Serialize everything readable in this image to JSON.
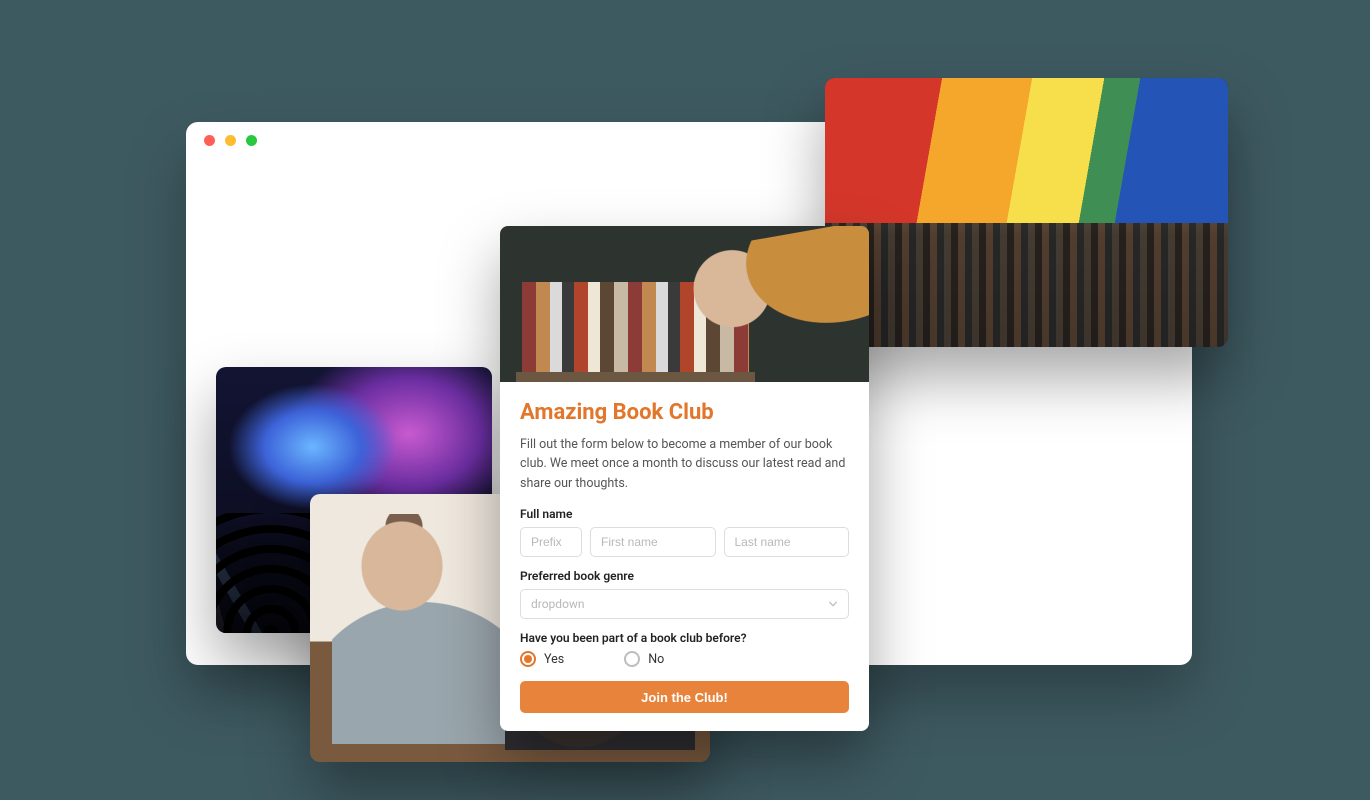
{
  "colors": {
    "accent": "#e2762a"
  },
  "window": {
    "traffic_lights": [
      "close",
      "minimize",
      "maximize"
    ]
  },
  "photos": {
    "rainbow_alt": "Crowd under large rainbow flag",
    "concert_alt": "Concert crowd with blue and purple stage lights",
    "couple_alt": "Two friends talking at a table"
  },
  "form": {
    "hero_alt": "Hand reaching for books on a shelf",
    "title": "Amazing Book Club",
    "description": "Fill out the form below to become a member of our book club. We meet once a month to discuss our latest read and share our thoughts.",
    "full_name": {
      "label": "Full name",
      "prefix_placeholder": "Prefix",
      "first_placeholder": "First name",
      "last_placeholder": "Last name"
    },
    "genre": {
      "label": "Preferred book genre",
      "selected": "dropdown"
    },
    "prior": {
      "label": "Have you been part of a book club before?",
      "yes": "Yes",
      "no": "No",
      "value": "yes"
    },
    "submit_label": "Join the Club!"
  }
}
